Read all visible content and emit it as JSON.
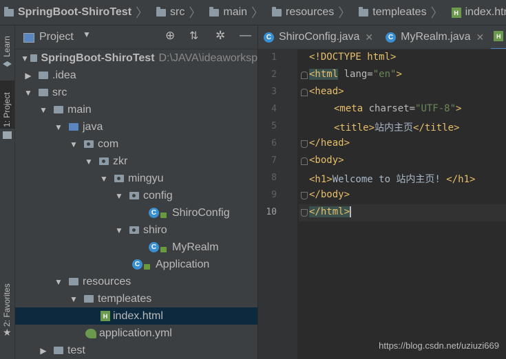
{
  "breadcrumb": {
    "items": [
      "SpringBoot-ShiroTest",
      "src",
      "main",
      "resources",
      "templeates",
      "index.html"
    ]
  },
  "toolstrip": {
    "learn": "Learn",
    "project": "1: Project",
    "favorites": "2: Favorites"
  },
  "project_panel": {
    "title": "Project",
    "tree": [
      {
        "label": "SpringBoot-ShiroTest",
        "path": "D:\\JAVA\\ideaworksp"
      },
      {
        "label": ".idea"
      },
      {
        "label": "src"
      },
      {
        "label": "main"
      },
      {
        "label": "java"
      },
      {
        "label": "com"
      },
      {
        "label": "zkr"
      },
      {
        "label": "mingyu"
      },
      {
        "label": "config"
      },
      {
        "label": "ShiroConfig"
      },
      {
        "label": "shiro"
      },
      {
        "label": "MyRealm"
      },
      {
        "label": "Application"
      },
      {
        "label": "resources"
      },
      {
        "label": "templeates"
      },
      {
        "label": "index.html"
      },
      {
        "label": "application.yml"
      },
      {
        "label": "test"
      }
    ]
  },
  "editor": {
    "tabs": [
      {
        "label": "ShiroConfig.java"
      },
      {
        "label": "MyRealm.java"
      }
    ],
    "line_numbers": [
      "1",
      "2",
      "3",
      "4",
      "5",
      "6",
      "7",
      "8",
      "9",
      "10"
    ],
    "lines": [
      {
        "parts": [
          "<!DOCTYPE html>"
        ]
      },
      {
        "parts": [
          "<html",
          " lang=",
          "\"en\"",
          ">"
        ]
      },
      {
        "parts": [
          "<head>"
        ]
      },
      {
        "parts": [
          "<meta",
          " charset=",
          "\"UTF-8\"",
          ">"
        ]
      },
      {
        "parts": [
          "<title>",
          "站内主页",
          "</title>"
        ]
      },
      {
        "parts": [
          "</head>"
        ]
      },
      {
        "parts": [
          "<body>"
        ]
      },
      {
        "parts": [
          "<h1>",
          "Welcome to 站内主页! ",
          "</h1>"
        ]
      },
      {
        "parts": [
          "</body>"
        ]
      },
      {
        "parts": [
          "</html>"
        ]
      }
    ]
  },
  "watermark": "https://blog.csdn.net/uziuzi669"
}
